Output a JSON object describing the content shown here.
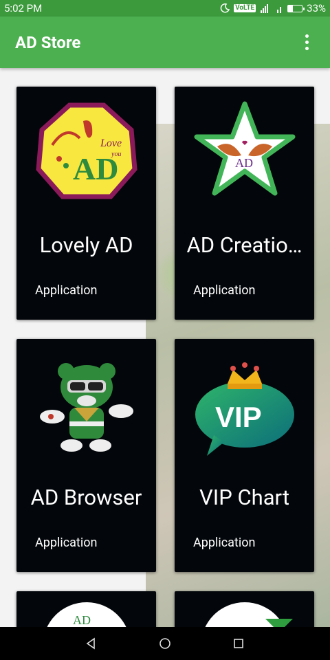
{
  "status_bar": {
    "time": "5:02 PM",
    "volte": "VoLTE",
    "lte": "LTE",
    "battery_text": "33%",
    "battery_level": 0.33
  },
  "app_bar": {
    "title": "AD Store"
  },
  "cards": [
    {
      "title": "Lovely AD",
      "subtitle": "Application",
      "logo_text": "AD",
      "logo_extra": "Love",
      "logo_extra2": "you"
    },
    {
      "title": "AD Creatio…",
      "subtitle": "Application",
      "logo_text": "AD"
    },
    {
      "title": "AD Browser",
      "subtitle": "Application"
    },
    {
      "title": "VIP Chart",
      "subtitle": "Application",
      "logo_text": "VIP"
    },
    {
      "logo_text": "AD"
    },
    {}
  ],
  "colors": {
    "status_bar": "#3c9a3c",
    "app_bar": "#4caf50",
    "card_bg": "#03060a",
    "text": "#ffffff"
  }
}
